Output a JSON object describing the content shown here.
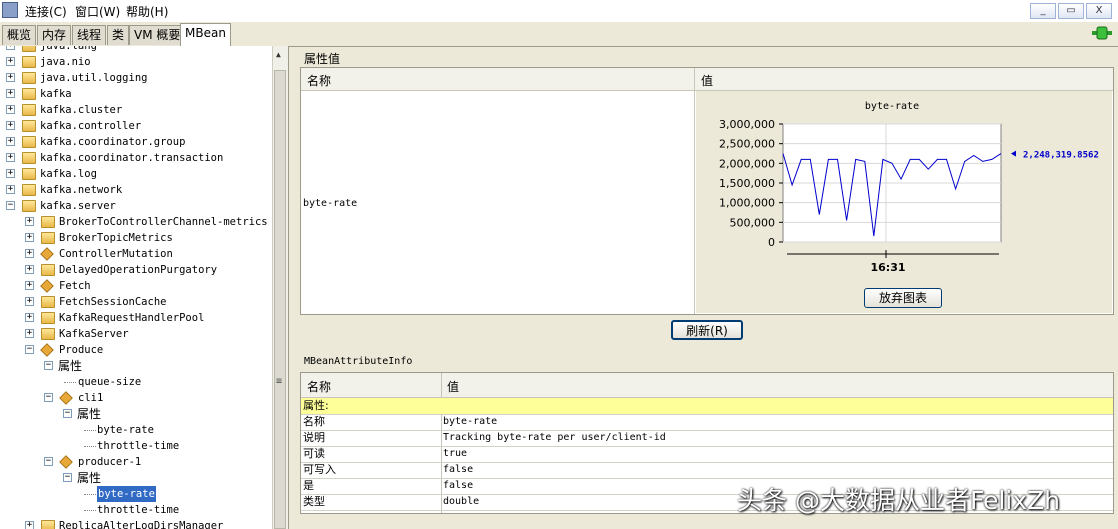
{
  "menu": {
    "items": [
      "连接(C)",
      "窗口(W)",
      "帮助(H)"
    ]
  },
  "window_controls": {
    "minimize": "_",
    "restore": "▭",
    "close": "X"
  },
  "tabs": [
    "概览",
    "内存",
    "线程",
    "类",
    "VM 概要",
    "MBean"
  ],
  "active_tab": "MBean",
  "tree": {
    "nodes": [
      {
        "label": "java.lang"
      },
      {
        "label": "java.nio"
      },
      {
        "label": "java.util.logging"
      },
      {
        "label": "kafka"
      },
      {
        "label": "kafka.cluster"
      },
      {
        "label": "kafka.controller"
      },
      {
        "label": "kafka.coordinator.group"
      },
      {
        "label": "kafka.coordinator.transaction"
      },
      {
        "label": "kafka.log"
      },
      {
        "label": "kafka.network"
      },
      {
        "label": "kafka.server"
      },
      {
        "label": "BrokerToControllerChannel-metrics"
      },
      {
        "label": "BrokerTopicMetrics"
      },
      {
        "label": "ControllerMutation"
      },
      {
        "label": "DelayedOperationPurgatory"
      },
      {
        "label": "Fetch"
      },
      {
        "label": "FetchSessionCache"
      },
      {
        "label": "KafkaRequestHandlerPool"
      },
      {
        "label": "KafkaServer"
      },
      {
        "label": "Produce"
      },
      {
        "label": "属性"
      },
      {
        "label": "queue-size"
      },
      {
        "label": "cli1"
      },
      {
        "label": "属性"
      },
      {
        "label": "byte-rate"
      },
      {
        "label": "throttle-time"
      },
      {
        "label": "producer-1"
      },
      {
        "label": "属性"
      },
      {
        "label": "byte-rate"
      },
      {
        "label": "throttle-time"
      },
      {
        "label": "ReplicaAlterLogDirsManager"
      }
    ],
    "selected": "byte-rate"
  },
  "attr_panel": {
    "title": "属性值",
    "col_name": "名称",
    "col_value": "值",
    "row_name": "byte-rate",
    "refresh_button": "刷新(R)",
    "discard_chart_button": "放弃图表"
  },
  "chart_data": {
    "type": "line",
    "title": "byte-rate",
    "yticks": [
      "3,000,000",
      "2,500,000",
      "2,000,000",
      "1,500,000",
      "1,000,000",
      "500,000",
      "0"
    ],
    "ylim": [
      0,
      3000000
    ],
    "x_tick_label": "16:31",
    "current_value_label": "2,248,319.8562",
    "series": [
      {
        "values": [
          2250000,
          1450000,
          2100000,
          2100000,
          700000,
          2100000,
          2100000,
          550000,
          2100000,
          2050000,
          150000,
          2100000,
          2000000,
          1600000,
          2100000,
          2100000,
          1850000,
          2100000,
          2100000,
          1350000,
          2050000,
          2200000,
          2050000,
          2100000,
          2248320
        ]
      }
    ],
    "color": "#0000cc",
    "grid": true
  },
  "info_panel": {
    "title": "MBeanAttributeInfo",
    "col_name": "名称",
    "col_value": "值",
    "rows": [
      {
        "k": "属性:",
        "v": ""
      },
      {
        "k": "名称",
        "v": "byte-rate"
      },
      {
        "k": "说明",
        "v": "Tracking byte-rate per user/client-id"
      },
      {
        "k": "可读",
        "v": "true"
      },
      {
        "k": "可写入",
        "v": "false"
      },
      {
        "k": "是",
        "v": "false"
      },
      {
        "k": "类型",
        "v": "double"
      }
    ]
  },
  "watermark": "头条 @大数据从业者FelixZh"
}
